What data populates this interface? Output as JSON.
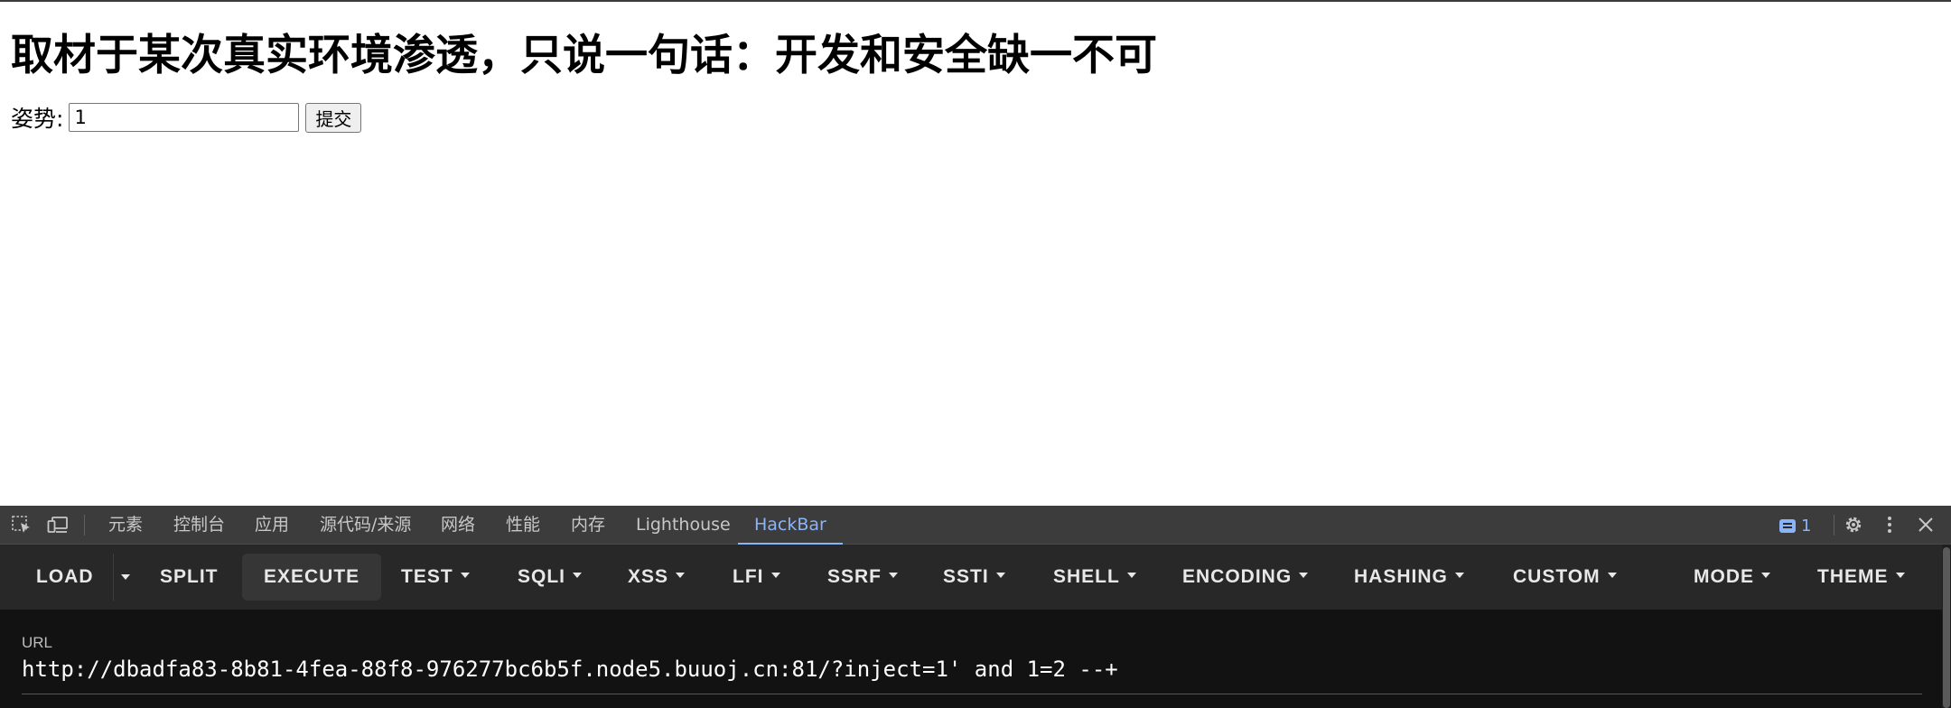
{
  "page": {
    "heading": "取材于某次真实环境渗透，只说一句话：开发和安全缺一不可",
    "form": {
      "label": "姿势:",
      "input_value": "1",
      "submit_label": "提交"
    }
  },
  "devtools": {
    "tabs": [
      {
        "label": "元素"
      },
      {
        "label": "控制台"
      },
      {
        "label": "应用"
      },
      {
        "label": "源代码/来源"
      },
      {
        "label": "网络"
      },
      {
        "label": "性能"
      },
      {
        "label": "内存"
      },
      {
        "label": "Lighthouse"
      },
      {
        "label": "HackBar",
        "active": true
      }
    ],
    "issues_count": "1",
    "icons": [
      "inspect-element-icon",
      "device-toolbar-icon",
      "issues-chat-icon",
      "gear-icon",
      "more-vertical-icon",
      "close-icon"
    ],
    "accent_color": "#8ab4f8"
  },
  "hackbar": {
    "buttons": {
      "load": "LOAD",
      "split": "SPLIT",
      "execute": "EXECUTE",
      "test": "TEST",
      "sqli": "SQLI",
      "xss": "XSS",
      "lfi": "LFI",
      "ssrf": "SSRF",
      "ssti": "SSTI",
      "shell": "SHELL",
      "encoding": "ENCODING",
      "hashing": "HASHING",
      "custom": "CUSTOM",
      "mode": "MODE",
      "theme": "THEME"
    },
    "url_label": "URL",
    "url_value": "http://dbadfa83-8b81-4fea-88f8-976277bc6b5f.node5.buuoj.cn:81/?inject=1' and 1=2 --+"
  }
}
